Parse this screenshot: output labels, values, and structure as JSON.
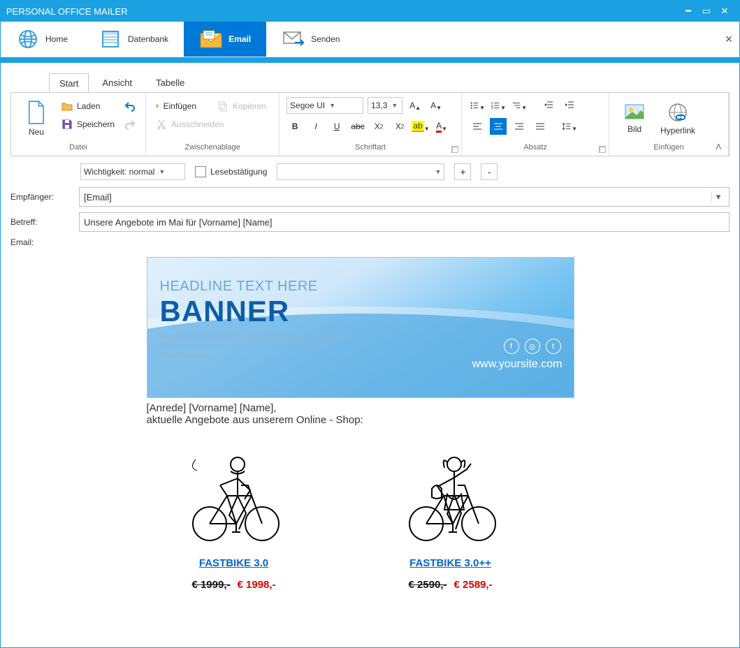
{
  "window": {
    "title": "PERSONAL OFFICE MAILER"
  },
  "menu": {
    "home": "Home",
    "datenbank": "Datenbank",
    "email": "Email",
    "senden": "Senden"
  },
  "tabs": {
    "start": "Start",
    "ansicht": "Ansicht",
    "tabelle": "Tabelle"
  },
  "ribbon": {
    "datei": {
      "cap": "Datei",
      "neu": "Neu",
      "laden": "Laden",
      "speichern": "Speichern"
    },
    "zwischen": {
      "cap": "Zwischenablage",
      "einfuegen": "Einfügen",
      "kopieren": "Kopieren",
      "ausschneiden": "Ausschneiden"
    },
    "schrift": {
      "cap": "Schriftart",
      "font": "Segoe UI",
      "size": "13,3"
    },
    "absatz": {
      "cap": "Absatz"
    },
    "einfuegen": {
      "cap": "Einfügen",
      "bild": "Bild",
      "hyperlink": "Hyperlink"
    }
  },
  "options": {
    "wichtigkeit": "Wichtigkeit: normal",
    "lesebest": "Lesebstätigung",
    "plus": "+",
    "minus": "-"
  },
  "form": {
    "empfaenger_lbl": "Empfänger:",
    "empfaenger_val": "[Email]",
    "betreff_lbl": "Betreff:",
    "betreff_val": "Unsere Angebote im Mai für [Vorname] [Name]",
    "email_lbl": "Email:"
  },
  "body": {
    "banner_head": "HEADLINE TEXT HERE",
    "banner_big": "BANNER",
    "banner_lorem": "Lorem ipsum dolor sit amet, consectetur adipisc. Proin ac nisl volutpat, dapibus orci vitae, cursus odio. Nulla pulvinar pharetra purus.",
    "banner_site": "www.yoursite.com",
    "greet": "[Anrede] [Vorname] [Name],",
    "intro": "aktuelle Angebote aus unserem Online - Shop:",
    "products": [
      {
        "name": "FASTBIKE 3.0",
        "old": "€ 1999,-",
        "new": "€ 1998,-"
      },
      {
        "name": "FASTBIKE 3.0++",
        "old": "€ 2590,-",
        "new": "€ 2589,-"
      }
    ]
  }
}
